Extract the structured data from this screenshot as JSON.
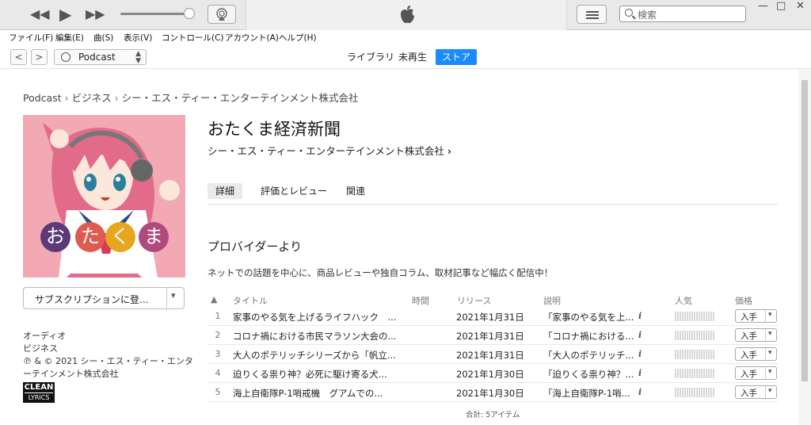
{
  "window": {
    "minimize": "—",
    "maximize": "□",
    "close": "✕"
  },
  "player": {
    "prev": "◀◀",
    "play": "▶",
    "next": "▶▶"
  },
  "search": {
    "placeholder": "検索"
  },
  "menu": [
    "ファイル(F)",
    "編集(E)",
    "曲(S)",
    "表示(V)",
    "コントロール(C)",
    "アカウント(A)",
    "ヘルプ(H)"
  ],
  "nav": {
    "back": "<",
    "forward": ">",
    "media_kind": "Podcast",
    "segments": [
      "ライブラリ",
      "未再生",
      "ストア"
    ],
    "active_segment": "ストア"
  },
  "breadcrumb": [
    "Podcast",
    "ビジネス",
    "シー・エス・ティー・エンターテインメント株式会社"
  ],
  "podcast": {
    "title": "おたくま経済新聞",
    "provider": "シー・エス・ティー・エンターテインメント株式会社",
    "artwork_text": [
      "お",
      "た",
      "く",
      "ま"
    ],
    "subscribe_label": "サブスクリプションに登...",
    "category_type": "オーディオ",
    "category": "ビジネス",
    "copyright": "℗ & © 2021 シー・エス・ティー・エンターテインメント株式会社",
    "clean_badge_top": "CLEAN",
    "clean_badge_bottom": "LYRICS"
  },
  "tabs": [
    "詳細",
    "評価とレビュー",
    "関連"
  ],
  "provider_section": {
    "heading": "プロバイダーより",
    "description": "ネットでの話題を中心に、商品レビューや独自コラム、取材記事など幅広く配信中！"
  },
  "table": {
    "sort_icon": "▲",
    "headers": {
      "title": "タイトル",
      "time": "時間",
      "release": "リリース",
      "description": "説明",
      "popularity": "人気",
      "price": "価格"
    },
    "rows": [
      {
        "num": "1",
        "title": "家事のやる気を上げるライフハック　...",
        "release": "2021年1月31日",
        "desc": "「家事のやる気を上...",
        "info": "i",
        "get": "入手"
      },
      {
        "num": "2",
        "title": "コロナ禍における市民マラソン大会の...",
        "release": "2021年1月31日",
        "desc": "「コロナ禍における...",
        "info": "i",
        "get": "入手"
      },
      {
        "num": "3",
        "title": "大人のポテリッチシリーズから「帆立...",
        "release": "2021年1月31日",
        "desc": "「大人のポテリッチ...",
        "info": "i",
        "get": "入手"
      },
      {
        "num": "4",
        "title": "迫りくる祟り神？必死に駆け寄る犬...",
        "release": "2021年1月30日",
        "desc": "「迫りくる祟り神？...",
        "info": "i",
        "get": "入手"
      },
      {
        "num": "5",
        "title": "海上自衛隊P-1哨戒機　グアムでの...",
        "release": "2021年1月30日",
        "desc": "「海上自衛隊P-1哨...",
        "info": "i",
        "get": "入手"
      }
    ],
    "total": "合計: 5アイテム"
  },
  "colors": {
    "accent": "#1a8cff",
    "artwork_bg": "#f2a9b4"
  }
}
